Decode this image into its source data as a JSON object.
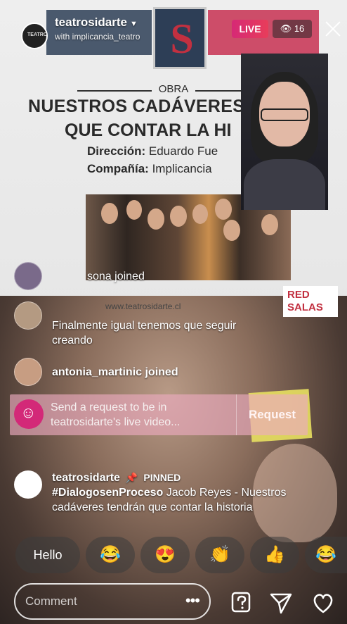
{
  "header": {
    "host_name": "teatrosidarte",
    "with_text": "with implicancia_teatro",
    "live_label": "LIVE",
    "viewer_count": "16"
  },
  "poster": {
    "obra": "OBRA",
    "title_line1": "NUESTROS CADÁVERES",
    "title_line2": "QUE CONTAR LA HI",
    "direccion_label": "Dirección:",
    "direccion_value": "Eduardo Fue",
    "compania_label": "Compañía:",
    "compania_value": "Implicancia",
    "website": "www.teatrosidarte.cl",
    "red_salas": "RED SALAS"
  },
  "comments": [
    {
      "user": "",
      "text": "sona joined"
    },
    {
      "user": "",
      "text": "Finalmente igual tenemos que seguir creando"
    },
    {
      "user": "antonia_martinic",
      "text": "joined"
    }
  ],
  "request": {
    "text_line1": "Send a request to be in",
    "text_line2": "teatrosidarte's live video...",
    "button_label": "Request"
  },
  "pinned": {
    "user": "teatrosidarte",
    "label": "PINNED",
    "hashtag": "#DialogosenProceso",
    "text_line1": "Jacob Reyes - Nuestros",
    "text_line2": "cadáveres tendrán que contar la historia"
  },
  "quick_reactions": {
    "hello": "Hello",
    "emojis": [
      "😂",
      "😍",
      "👏",
      "👍",
      "😂"
    ]
  },
  "comment_input": {
    "placeholder": "Comment",
    "more": "•••"
  },
  "colors": {
    "live_gradient_start": "#d62976",
    "live_gradient_end": "#e83d5a",
    "request_icon": "#d32978"
  },
  "icons": {
    "question": "question-box-icon",
    "send": "send-icon",
    "heart": "heart-icon",
    "close": "close-icon"
  }
}
